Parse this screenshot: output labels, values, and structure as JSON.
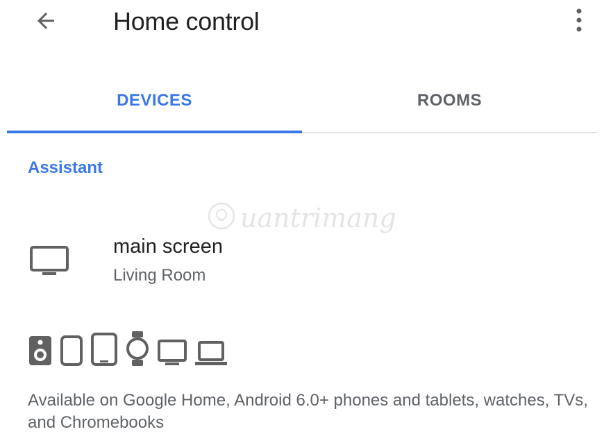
{
  "appbar": {
    "title": "Home control",
    "back_icon": "arrow-back-icon",
    "more_icon": "more-vert-icon"
  },
  "tabs": [
    {
      "label": "DEVICES",
      "active": true
    },
    {
      "label": "ROOMS",
      "active": false
    }
  ],
  "section": {
    "header": "Assistant",
    "device": {
      "name": "main screen",
      "room": "Living Room",
      "icon": "tv-icon"
    }
  },
  "supported_device_icons": [
    "speaker-icon",
    "phone-icon",
    "tablet-icon",
    "watch-icon",
    "tv-icon",
    "laptop-icon"
  ],
  "available_text": "Available on Google Home, Android 6.0+ phones and tablets, watches, TVs, and Chromebooks",
  "watermark": "uantrimang",
  "colors": {
    "accent": "#3b78e7",
    "primary_text": "#212121",
    "secondary_text": "#5f6368",
    "icon_gray": "#616161",
    "divider": "#e2e2e2"
  }
}
